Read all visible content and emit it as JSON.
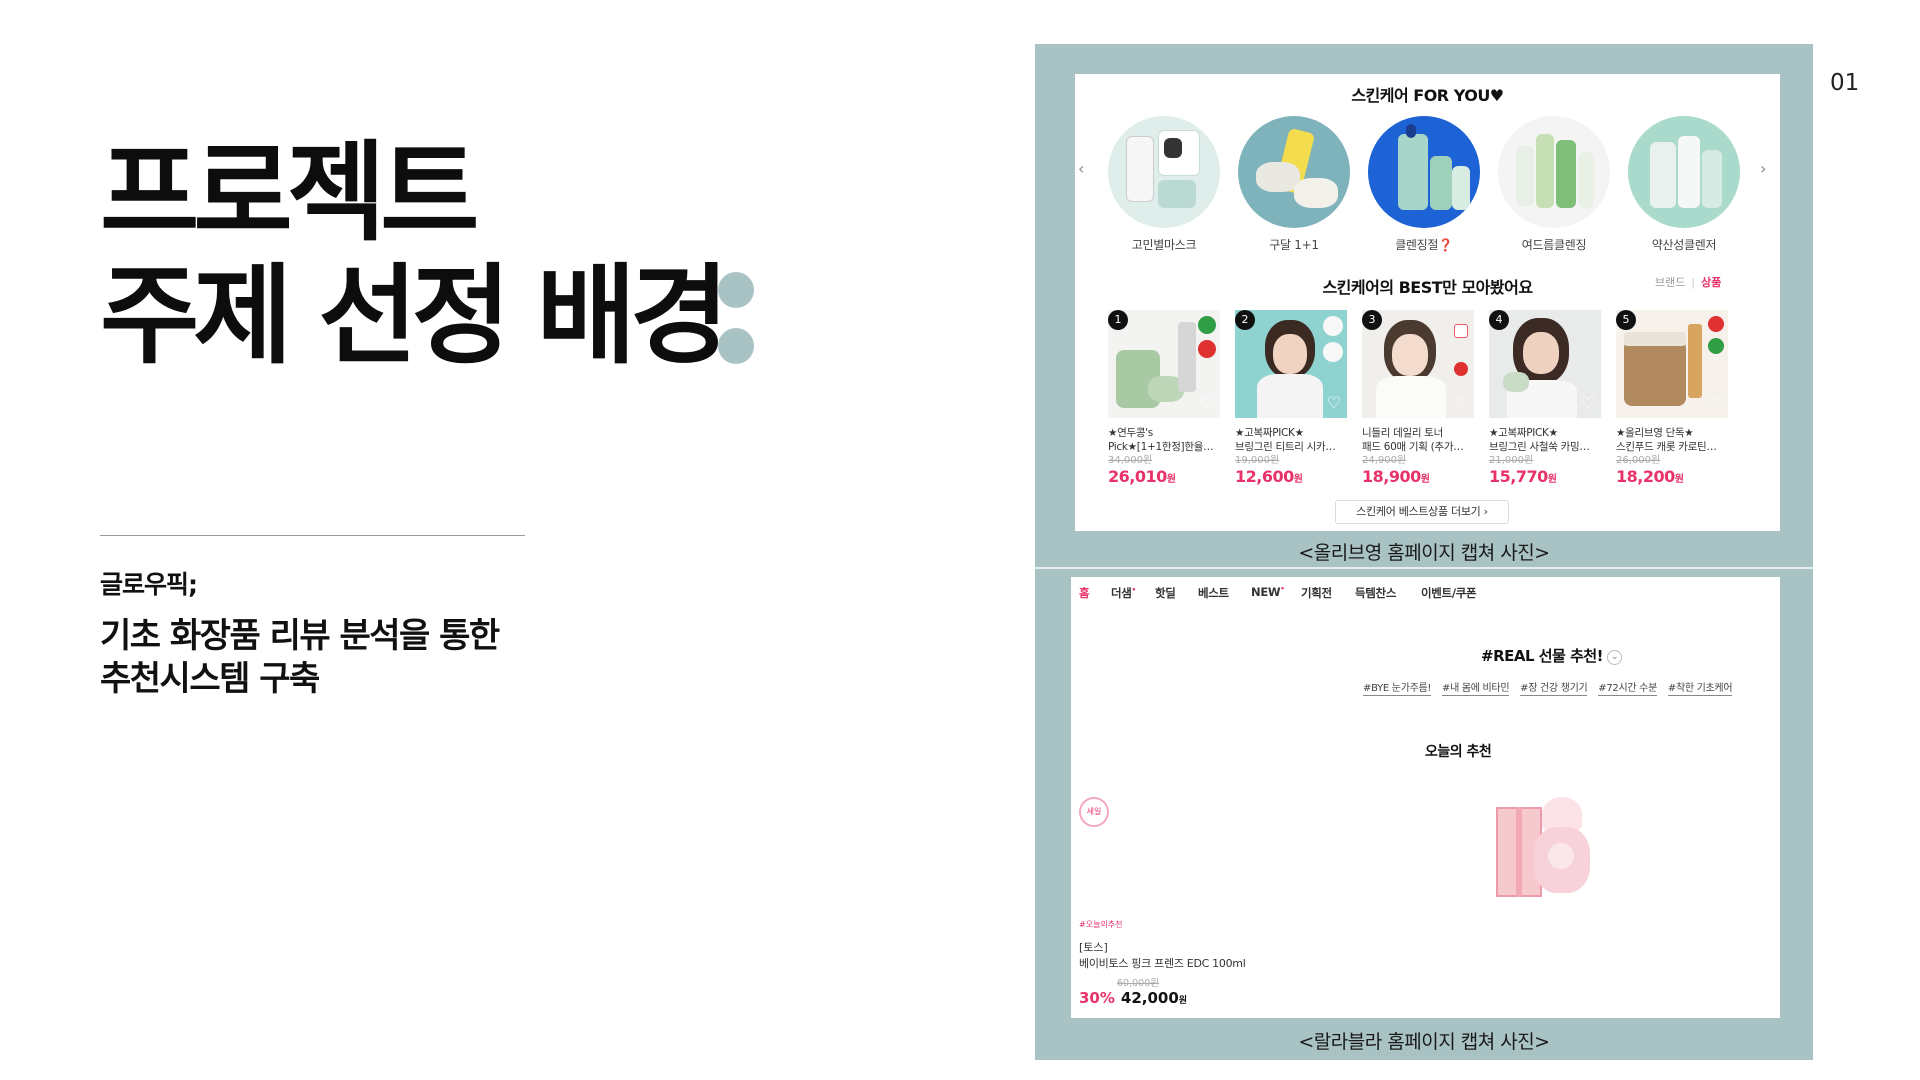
{
  "slide": {
    "title_line1": "프로젝트",
    "title_line2": "주제 선정 배경",
    "team": "글로우픽;",
    "subject_line1": "기초 화장품 리뷰 분석을 통한",
    "subject_line2": "추천시스템 구축",
    "page_number": "01"
  },
  "colors": {
    "panel": "#a9c2c3",
    "accent_pink": "#e8336a",
    "title": "#0d0d0d"
  },
  "oliveyoung": {
    "caption": "<올리브영 홈페이지 캡쳐 사진>",
    "section_title": "스킨케어 FOR YOU♥",
    "prev_arrow": "‹",
    "next_arrow": "›",
    "circles": [
      {
        "label": "고민별마스크",
        "icon": "mask-products"
      },
      {
        "label": "구달 1+1",
        "icon": "cream-products"
      },
      {
        "label": "클렌징절❓",
        "icon": "cleansing-products"
      },
      {
        "label": "여드름클렌징",
        "icon": "acne-cleansing-tubes"
      },
      {
        "label": "약산성클렌저",
        "icon": "weak-acid-cleanser"
      }
    ],
    "best_title": "스킨케어의 BEST만 모아봤어요",
    "tab_brand": "브랜드",
    "tab_sep": "|",
    "tab_product": "상품",
    "products": [
      {
        "rank": "1",
        "name1": "★연두콩's",
        "name2": "Pick★[1+1한정]한율…",
        "old_price": "34,000원",
        "price": "26,010",
        "won": "원"
      },
      {
        "rank": "2",
        "name1": "★고복짜PICK★",
        "name2": "브링그린 티트리 시카…",
        "old_price": "19,000원",
        "price": "12,600",
        "won": "원"
      },
      {
        "rank": "3",
        "name1": "니들리 데일리 토너",
        "name2": "패드 60매 기획 (추가…",
        "old_price": "24,900원",
        "price": "18,900",
        "won": "원"
      },
      {
        "rank": "4",
        "name1": "★고복짜PICK★",
        "name2": "브링그린 사철쑥 카밍…",
        "old_price": "21,000원",
        "price": "15,770",
        "won": "원"
      },
      {
        "rank": "5",
        "name1": "★올리브영 단독★",
        "name2": "스킨푸드 캐롯 카로틴…",
        "old_price": "26,000원",
        "price": "18,200",
        "won": "원"
      }
    ],
    "more_button": "스킨케어 베스트상품 더보기 ›"
  },
  "lalavla": {
    "caption": "<랄라블라 홈페이지 캡쳐 사진>",
    "nav": [
      "홈",
      "더샘",
      "핫딜",
      "베스트",
      "NEW",
      "기획전",
      "득템찬스",
      "이벤트/쿠폰"
    ],
    "real_title": "#REAL 선물 추천!",
    "real_chevron": "⌄",
    "tags": [
      "#BYE 눈가주름!",
      "#내 몸에 비타민",
      "#장 건강 챙기기",
      "#72시간 수분",
      "#착한 기초케어"
    ],
    "today_title": "오늘의 추천",
    "sale_badge": "세일",
    "product_tag": "#오늘의추천",
    "brand": "[토스]",
    "product_name": "베이비토스 핑크 프렌즈 EDC 100ml",
    "old_price": "60,000원",
    "discount": "30%",
    "price": "42,000",
    "won": "원"
  }
}
